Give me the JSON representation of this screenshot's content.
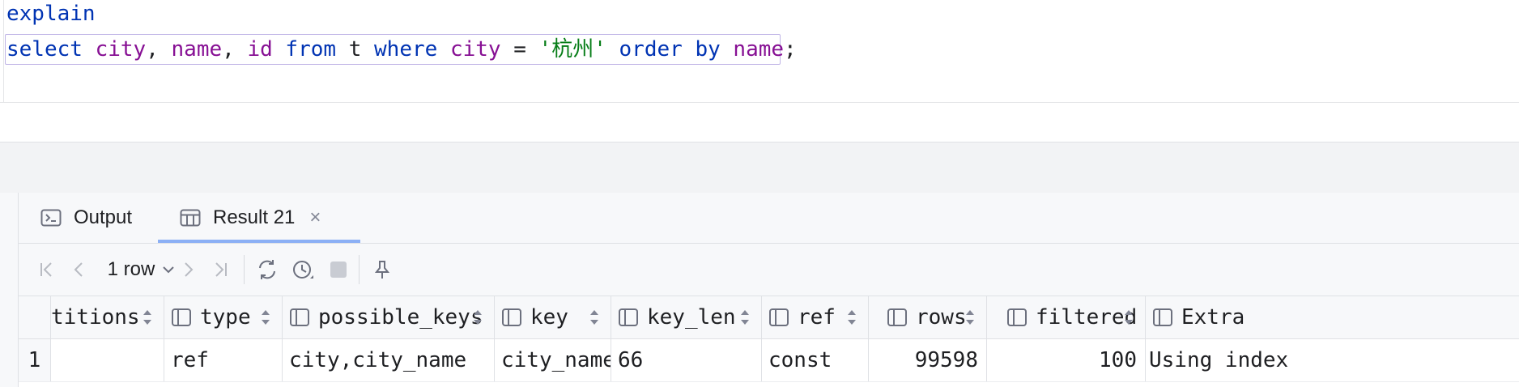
{
  "editor": {
    "line1": {
      "kw": "explain"
    },
    "line2": {
      "select": "select",
      "col1": "city",
      "comma1": ", ",
      "col2": "name",
      "comma2": ", ",
      "col3": "id",
      "from": "from",
      "table": "t",
      "where": "where",
      "col4": "city",
      "eq": " = ",
      "value": "'杭州'",
      "order": "order",
      "by": "by",
      "col5": "name",
      "semicolon": ";"
    }
  },
  "tabs": [
    {
      "label": "Output",
      "icon": "terminal-icon"
    },
    {
      "label": "Result 21",
      "icon": "table-icon",
      "close": "×"
    }
  ],
  "toolbar": {
    "row_count": "1 row",
    "icons": [
      "first-page-icon",
      "prev-page-icon",
      "next-page-icon",
      "last-page-icon",
      "refresh-icon",
      "history-icon",
      "stop-icon",
      "pin-icon"
    ]
  },
  "grid": {
    "columns": [
      "titions",
      "type",
      "possible_keys",
      "key",
      "key_len",
      "ref",
      "rows",
      "filtered",
      "Extra"
    ],
    "rows": [
      {
        "num": "1",
        "titions": "",
        "type": "ref",
        "possible_keys": "city,city_name",
        "key": "city_name",
        "key_len": "66",
        "ref": "const",
        "rows": "99598",
        "filtered": "100",
        "Extra": "Using index"
      }
    ]
  },
  "colors": {
    "keyword": "#0033b3",
    "identifier": "#871094",
    "string": "#067d17",
    "accent": "#3574f0"
  }
}
